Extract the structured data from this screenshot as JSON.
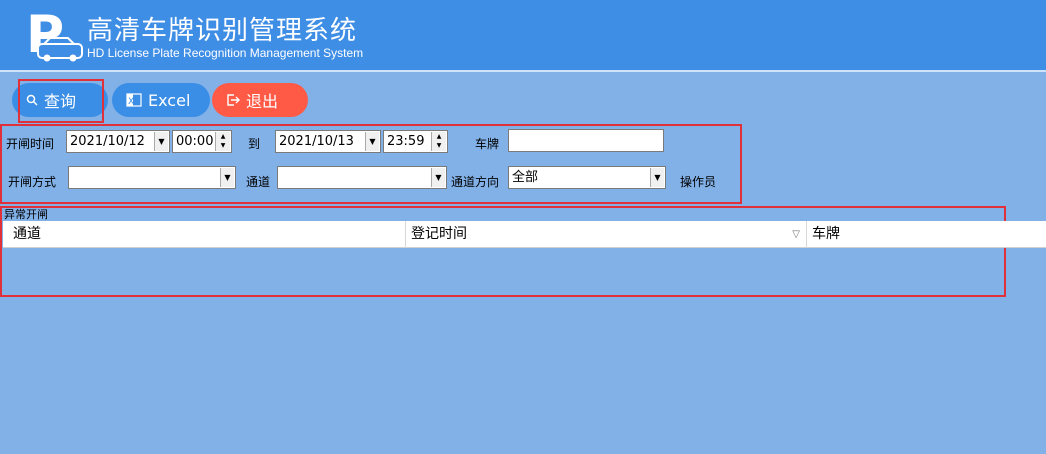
{
  "header": {
    "logo_letter": "P",
    "title": "高清车牌识别管理系统",
    "subtitle": "HD License Plate Recognition Management System"
  },
  "toolbar": {
    "query_label": "查询",
    "excel_label": "Excel",
    "exit_label": "退出"
  },
  "filters": {
    "open_time_label": "开闸时间",
    "from_date": "2021/10/12",
    "from_time": "00:00",
    "to_label": "到",
    "to_date": "2021/10/13",
    "to_time": "23:59",
    "plate_label": "车牌",
    "plate_value": "",
    "open_method_label": "开闸方式",
    "open_method_value": "",
    "channel_label": "通道",
    "channel_value": "",
    "direction_label": "通道方向",
    "direction_value": "全部",
    "operator_label": "操作员"
  },
  "results": {
    "group_title": "异常开闸",
    "columns": [
      "通道",
      "登记时间",
      "车牌"
    ],
    "rows": []
  },
  "colors": {
    "header_bg": "#3f8ee6",
    "body_bg": "#82b1e8",
    "exit_button": "#ff5a45",
    "highlight_border": "#e0303a"
  }
}
